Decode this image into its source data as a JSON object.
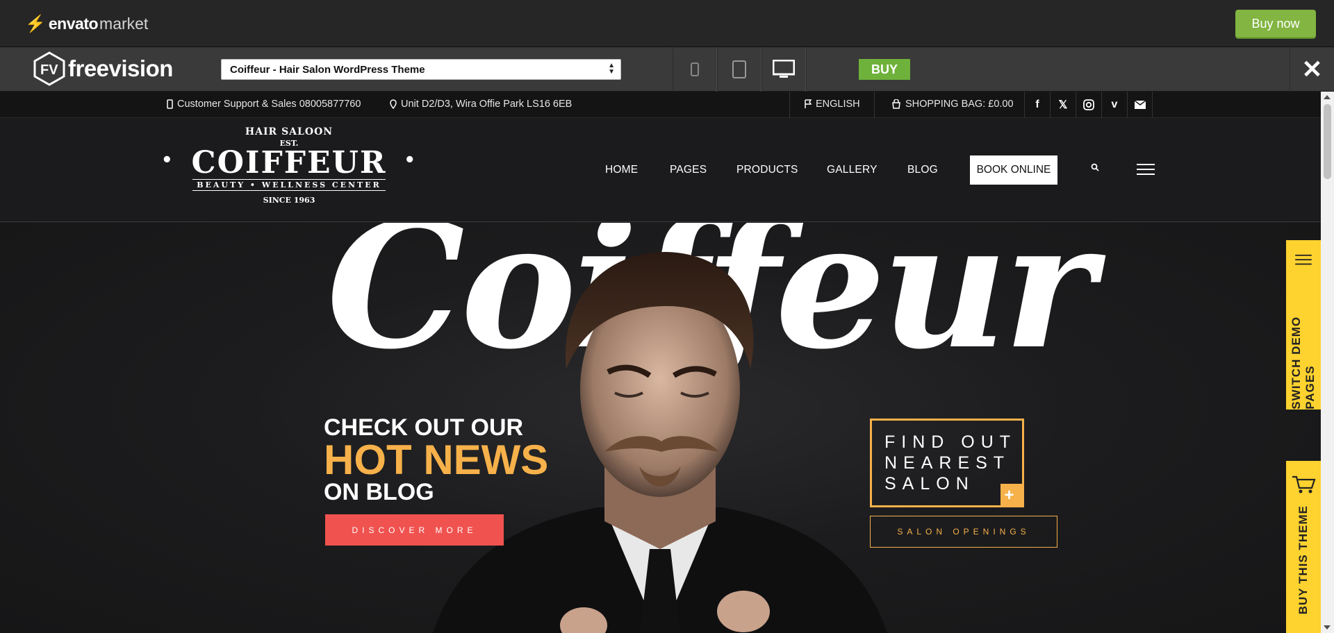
{
  "envato": {
    "logo_brand": "envato",
    "logo_market": "market",
    "buy_now": "Buy now"
  },
  "freevision": {
    "logo_text": "freevision",
    "theme_select": "Coiffeur - Hair Salon WordPress Theme",
    "buy_label": "BUY",
    "close_label": "✕"
  },
  "topbar": {
    "support": "Customer Support & Sales 08005877760",
    "address": "Unit D2/D3, Wira Offie Park LS16 6EB",
    "language": "ENGLISH",
    "shopping_bag": "SHOPPING BAG:  £0.00"
  },
  "logo": {
    "saloon": "HAIR SALOON",
    "est": "EST.",
    "name": "COIFFEUR",
    "tagline": "BEAUTY • WELLNESS CENTER",
    "since": "SINCE 1963"
  },
  "nav": {
    "home": "HOME",
    "pages": "PAGES",
    "products": "PRODUCTS",
    "gallery": "GALLERY",
    "blog": "BLOG",
    "book_online": "BOOK ONLINE"
  },
  "hero": {
    "big_title": "Coiffeur",
    "line1": "CHECK OUT OUR",
    "line2": "HOT NEWS",
    "line3": "ON BLOG",
    "discover": "DISCOVER MORE",
    "find_line1": "FIND OUT",
    "find_line2": "NEAREST",
    "find_line3": "SALON",
    "find_plus": "+",
    "salon_openings": "SALON OPENINGS"
  },
  "side_tabs": {
    "demo": "SWITCH DEMO PAGES",
    "buy": "BUY THIS THEME"
  },
  "colors": {
    "accent_gold": "#f7b14a",
    "accent_red": "#f0524f",
    "envato_green": "#82b541",
    "side_yellow": "#fed22f"
  }
}
